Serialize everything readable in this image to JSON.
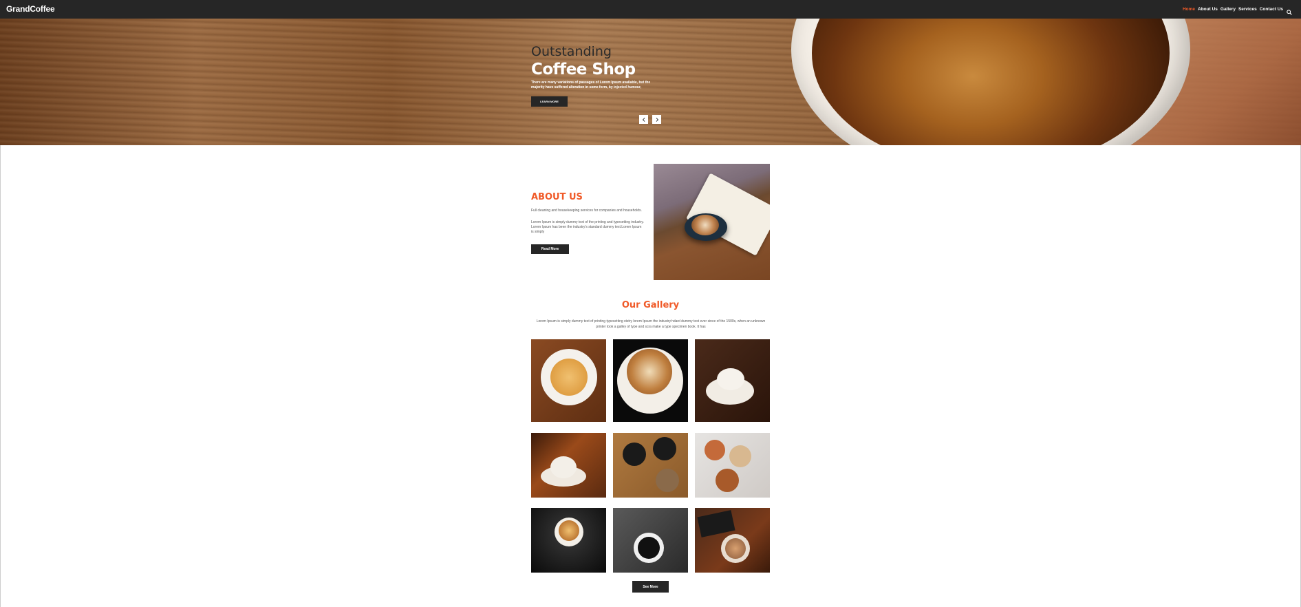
{
  "navbar": {
    "brand": "GrandCoffee",
    "links": [
      {
        "label": "Home",
        "active": true
      },
      {
        "label": "About Us",
        "active": false
      },
      {
        "label": "Gallery",
        "active": false
      },
      {
        "label": "Services",
        "active": false
      },
      {
        "label": "Contact Us",
        "active": false
      }
    ],
    "search_icon": "search-icon"
  },
  "hero": {
    "pre_title": "Outstanding",
    "title": "Coffee Shop",
    "text": "There are many variations of passages of Lorem Ipsum available, but the majority have suffered alteration in some form, by injected humour,",
    "button_label": "LEARN MORE",
    "prev_icon": "chevron-left-icon",
    "next_icon": "chevron-right-icon"
  },
  "about": {
    "title": "ABOUT US",
    "text1": "Full cleaning and housekeeping services for companies and households.",
    "text2": "Lorem Ipsum is simply dummy text of the printing and typesetting industry. Lorem Ipsum has been the industry's standard dummy text.Lorem Ipsum is simply",
    "button_label": "Read More"
  },
  "gallery": {
    "title": "Our Gallery",
    "description": "Lorem Ipsum is simply dummy text of printing typesetting ststry lorem Ipsum the industry'ndard dummy text ever since of the 1500s, when an unknown printer took a galley of type and scra make a type specimen book. It has",
    "see_more_label": "See More"
  },
  "colors": {
    "accent": "#f05a28",
    "dark": "#262626",
    "white": "#ffffff"
  }
}
